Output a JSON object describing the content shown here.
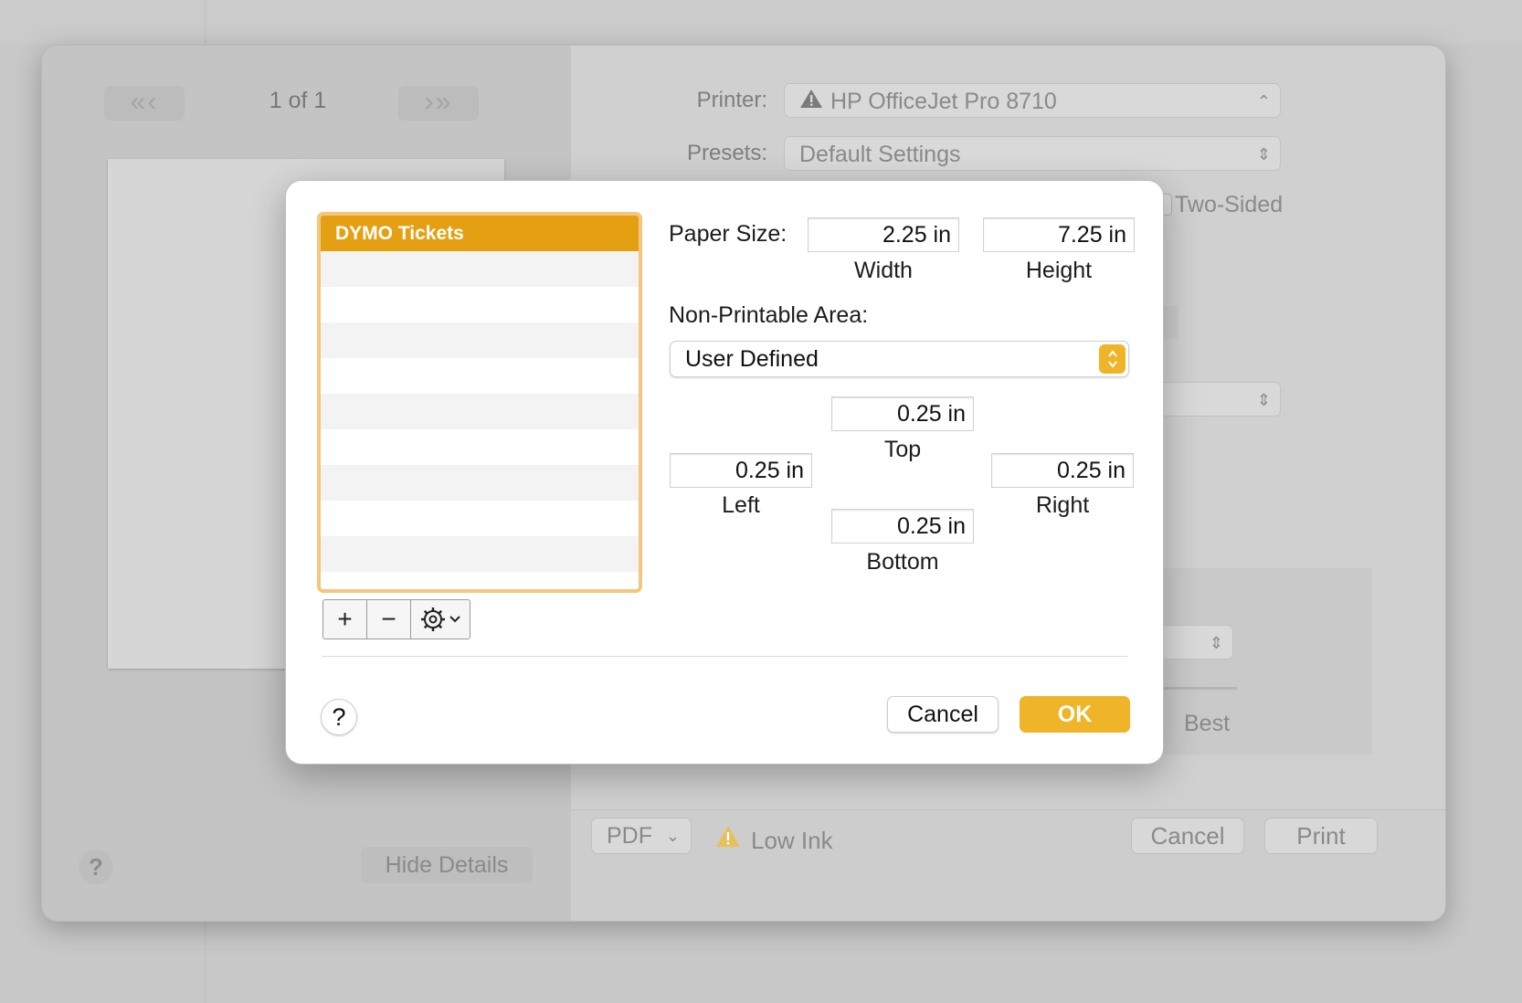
{
  "background_window": {
    "page_indicator": "1 of 1",
    "nav_first_prev": "«‹",
    "nav_next_last": "›»",
    "printer_label": "Printer:",
    "printer_value": "HP OfficeJet Pro 8710",
    "presets_label": "Presets:",
    "presets_value": "Default Settings",
    "two_sided_label": "Two-Sided",
    "best_label": "Best",
    "help_label": "?",
    "hide_details_label": "Hide Details",
    "pdf_label": "PDF",
    "low_ink_label": "Low Ink",
    "cancel_label": "Cancel",
    "print_label": "Print"
  },
  "sheet": {
    "list": {
      "items": [
        "DYMO Tickets"
      ]
    },
    "toolbar": {
      "add_label": "+",
      "remove_label": "−"
    },
    "paper_size": {
      "label": "Paper Size:",
      "width_value": "2.25 in",
      "width_caption": "Width",
      "height_value": "7.25 in",
      "height_caption": "Height"
    },
    "non_printable": {
      "label": "Non-Printable Area:",
      "selected": "User Defined",
      "top_value": "0.25 in",
      "top_caption": "Top",
      "left_value": "0.25 in",
      "left_caption": "Left",
      "right_value": "0.25 in",
      "right_caption": "Right",
      "bottom_value": "0.25 in",
      "bottom_caption": "Bottom"
    },
    "help_label": "?",
    "cancel_label": "Cancel",
    "ok_label": "OK",
    "accent_color": "#f0b429",
    "selection_color": "#e4a012"
  }
}
